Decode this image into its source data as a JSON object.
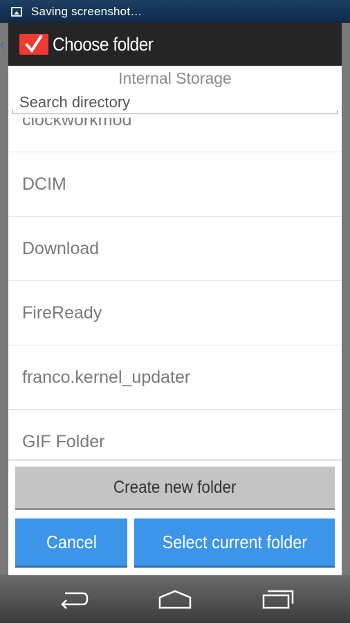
{
  "status_bar": {
    "notification_text": "Saving screenshot…",
    "icon": "image-icon"
  },
  "dialog": {
    "title": "Choose folder",
    "app_icon": "checkmark-icon",
    "storage_label": "Internal Storage",
    "search": {
      "placeholder": "Search directory",
      "value": ""
    },
    "folders": [
      "clockworkmod",
      "DCIM",
      "Download",
      "FireReady",
      "franco.kernel_updater",
      "GIF Folder"
    ],
    "buttons": {
      "create": "Create new folder",
      "cancel": "Cancel",
      "select": "Select current folder"
    }
  },
  "nav_bar": {
    "icons": [
      "back-icon",
      "home-icon",
      "recent-apps-icon"
    ]
  },
  "colors": {
    "accent": "#3d95ea",
    "app_icon": "#ee3b34",
    "header": "#252525"
  }
}
